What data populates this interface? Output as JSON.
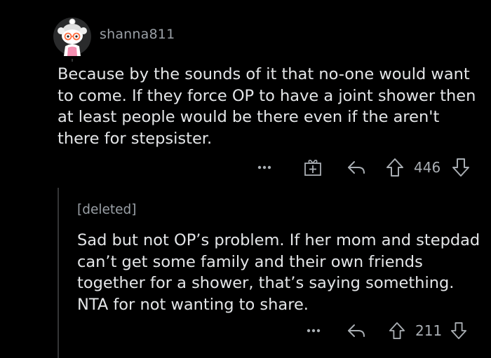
{
  "theme": {
    "background": "#000000",
    "text": "#e4e6e8",
    "muted": "#9aa0a6",
    "thread_line": "#343536"
  },
  "comment": {
    "author": "shanna811",
    "avatar_icon": "snoo-avatar-icon",
    "body": "Because by the sounds of it that no-one would want to come. If they force OP to have a joint shower then at least people would be there even if the aren't there for stepsister.",
    "actions": {
      "more_icon": "more-dots-icon",
      "award_icon": "gift-award-icon",
      "reply_icon": "reply-arrow-icon",
      "upvote_icon": "upvote-arrow-icon",
      "downvote_icon": "downvote-arrow-icon",
      "score": "446"
    }
  },
  "reply": {
    "author": "[deleted]",
    "body": "Sad but not OP’s problem. If her mom and stepdad can’t get some family and their own friends together for a shower, that’s saying something. NTA for not wanting to share.",
    "actions": {
      "more_icon": "more-dots-icon",
      "reply_icon": "reply-arrow-icon",
      "upvote_icon": "upvote-arrow-icon",
      "downvote_icon": "downvote-arrow-icon",
      "score": "211"
    }
  }
}
